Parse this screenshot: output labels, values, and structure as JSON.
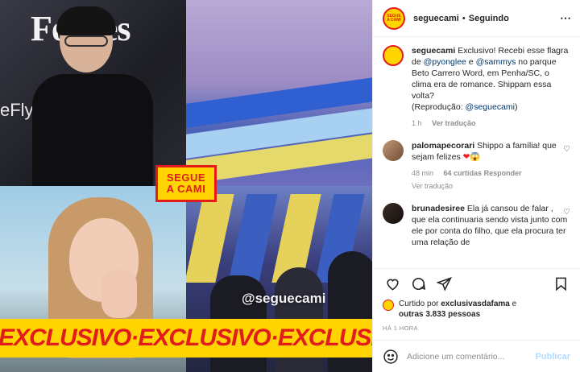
{
  "media": {
    "forbes_text": "Forbes",
    "brand_text": "eFly",
    "watermark_handle": "@seguecami",
    "logo_line1": "SEGUE",
    "logo_line2": "A CAMI",
    "banner_text": "EXCLUSIVO·EXCLUSIVO·EXCLUSIVO"
  },
  "header": {
    "username": "seguecami",
    "separator": "•",
    "follow_status": "Seguindo",
    "more_icon": "⋯"
  },
  "caption": {
    "username": "seguecami",
    "text_1": " Exclusivo! Recebi esse flagra de ",
    "mention_1": "@pyonglee",
    "text_2": " e ",
    "mention_2": "@sammys",
    "text_3": " no parque Beto Carrero Word, em Penha/SC, o clima era de romance. Shippam essa volta?",
    "text_4": "(Reprodução: ",
    "mention_3": "@seguecami",
    "text_5": ")",
    "time": "1 h",
    "translate": "Ver tradução"
  },
  "comments": [
    {
      "username": "palomapecorari",
      "text": " Shippo a família! que sejam felizes ",
      "emoji": "❤",
      "emoji2": "😱",
      "time": "48 min",
      "likes": "64 curtidas",
      "reply": "Responder",
      "translate": "Ver tradução"
    },
    {
      "username": "brunadesiree",
      "text": " Ela já cansou de falar , que ela continuaria sendo vista junto com ele por conta do filho, que ela procura ter uma relação de"
    }
  ],
  "likes": {
    "prefix": "Curtido por ",
    "user": "exclusivasdafama",
    "middle": " e",
    "others": "outras 3.833 pessoas"
  },
  "timestamp": "HÁ 1 HORA",
  "add_comment": {
    "placeholder": "Adicione um comentário...",
    "publish": "Publicar"
  },
  "colors": {
    "brand_yellow": "#ffd400",
    "brand_red": "#e21c1c",
    "mention_blue": "#00376b",
    "muted": "#8e8e8e",
    "publish_disabled": "#b3dbff"
  }
}
